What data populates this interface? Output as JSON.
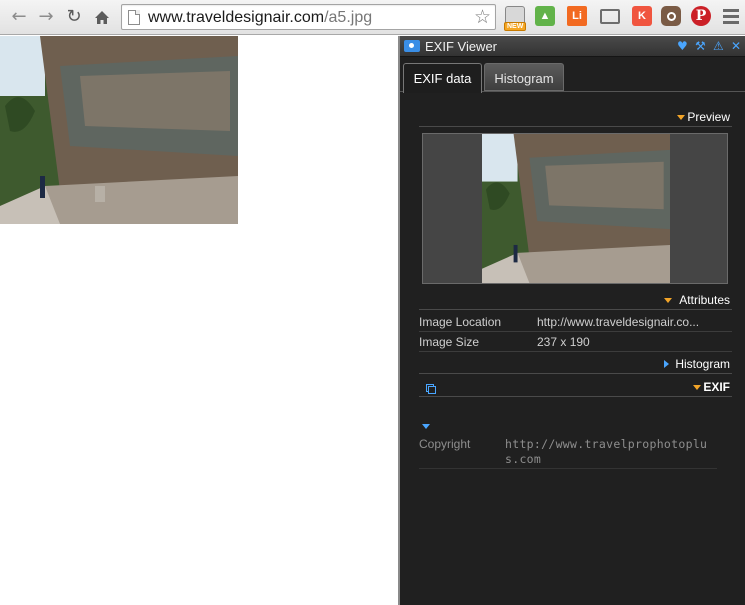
{
  "browser": {
    "url_host": "www.traveldesignair.com",
    "url_path": "/a5.jpg",
    "extensions": [
      {
        "name": "new-extension",
        "badge": "NEW"
      },
      {
        "name": "evernote-icon"
      },
      {
        "name": "li-extension",
        "label": "Li"
      },
      {
        "name": "cast-icon"
      },
      {
        "name": "k-extension",
        "label": "K"
      },
      {
        "name": "instagram-icon"
      },
      {
        "name": "pinterest-icon",
        "label": "P"
      }
    ]
  },
  "exif_viewer": {
    "title": "EXIF Viewer",
    "tabs": [
      "EXIF data",
      "Histogram"
    ],
    "sections": {
      "preview": "Preview",
      "attributes": "Attributes",
      "histogram": "Histogram",
      "exif": "EXIF"
    },
    "attributes": [
      {
        "key": "Image Location",
        "value": "http://www.traveldesignair.co..."
      },
      {
        "key": "Image Size",
        "value": "237 x 190"
      }
    ],
    "exif_rows": [
      {
        "key": "Copyright",
        "value": "http://www.travelprophotoplus.com"
      }
    ]
  },
  "colors": {
    "panel_bg": "#202020",
    "accent_orange": "#f2a428",
    "accent_blue": "#4aa6ff"
  }
}
